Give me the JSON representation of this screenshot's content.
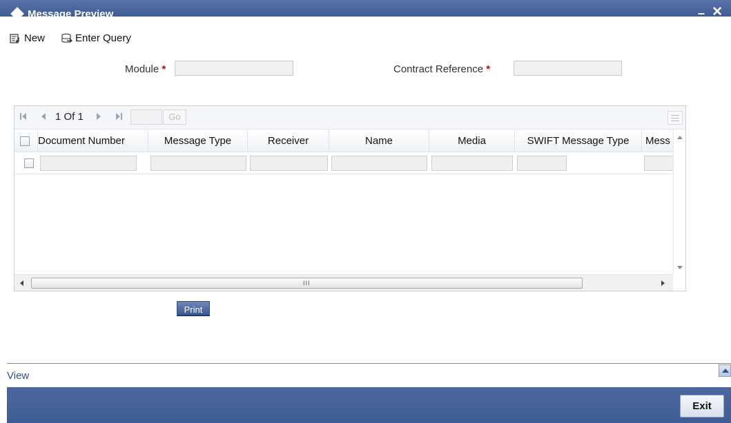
{
  "window": {
    "title": "Message Preview",
    "minimize": "–",
    "close": "✕"
  },
  "toolbar": {
    "new_label": "New",
    "enter_query_label": "Enter Query"
  },
  "form": {
    "module_label": "Module",
    "contract_reference_label": "Contract Reference",
    "required_marker": "*",
    "module_value": "",
    "contract_reference_value": ""
  },
  "pager": {
    "first": "⏮",
    "prev": "◀",
    "page_text": "1 Of 1",
    "next": "▶",
    "last": "⏭",
    "go_label": "Go",
    "page_input": ""
  },
  "table": {
    "columns": [
      "Document Number",
      "Message Type",
      "Receiver",
      "Name",
      "Media",
      "SWIFT Message Type",
      "Mess"
    ],
    "rows": [
      [
        "",
        "",
        "",
        "",
        "",
        "",
        ""
      ]
    ],
    "hscroll_grip": "III"
  },
  "actions": {
    "print_label": "Print"
  },
  "footer": {
    "view_label": "View",
    "exit_label": "Exit"
  },
  "colors": {
    "titlebar": "#4a67a0",
    "accent": "#3f5c94",
    "required": "#d40000",
    "link": "#2a4f9a"
  }
}
